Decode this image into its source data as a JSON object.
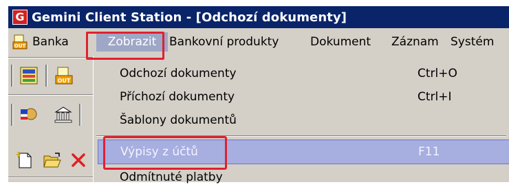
{
  "window": {
    "app_icon_letter": "G",
    "title": "Gemini Client Station - [Odchozí dokumenty]"
  },
  "menubar": {
    "items": [
      {
        "label": "Banka"
      },
      {
        "label": "Zobrazit"
      },
      {
        "label": "Bankovní produkty"
      },
      {
        "label": "Dokument"
      },
      {
        "label": "Záznam"
      },
      {
        "label": "Systém"
      }
    ],
    "selected": "Zobrazit"
  },
  "dropdown": {
    "items": [
      {
        "label": "Odchozí dokumenty",
        "shortcut": "Ctrl+O"
      },
      {
        "label": "Příchozí dokumenty",
        "shortcut": "Ctrl+I"
      },
      {
        "label": "Šablony dokumentů",
        "shortcut": ""
      },
      {
        "label": "Výpisy z účtů",
        "shortcut": "F11"
      },
      {
        "label": "Odmítnuté platby",
        "shortcut": ""
      }
    ],
    "highlighted": "Výpisy z účtů"
  },
  "colors": {
    "titlebar": "#0a246a",
    "menubar": "#d4d0c8",
    "selected_menu": "#9ea7c6",
    "highlight": "#a7aee0",
    "annotation": "#e02030"
  }
}
